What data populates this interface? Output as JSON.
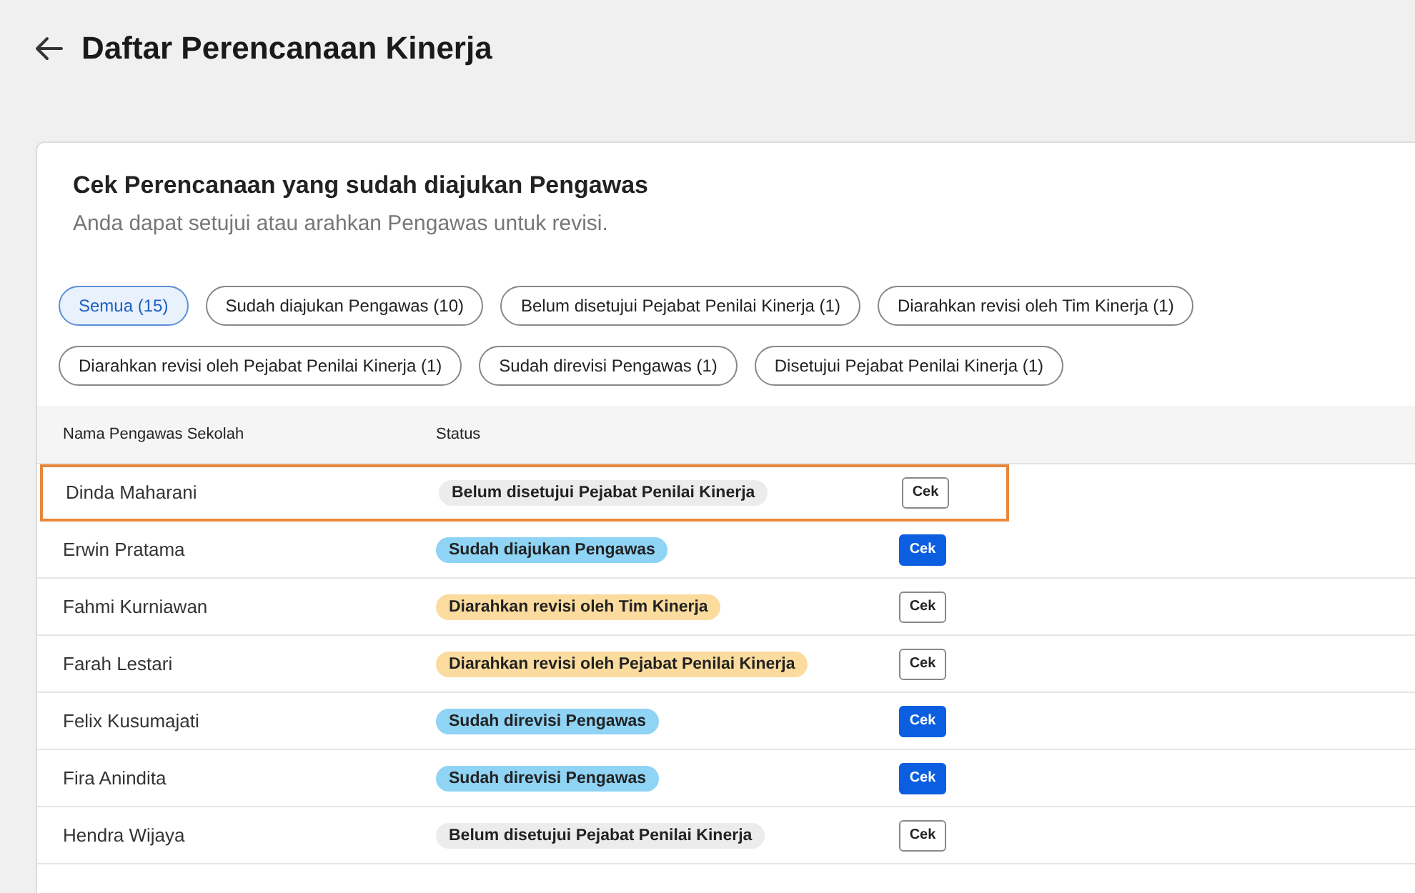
{
  "page": {
    "title": "Daftar Perencanaan Kinerja"
  },
  "card": {
    "title": "Cek Perencanaan yang sudah diajukan Pengawas",
    "subtitle": "Anda dapat setujui atau arahkan Pengawas untuk revisi."
  },
  "filters": [
    {
      "label": "Semua (15)",
      "selected": true
    },
    {
      "label": "Sudah diajukan Pengawas (10)",
      "selected": false
    },
    {
      "label": "Belum disetujui Pejabat Penilai Kinerja (1)",
      "selected": false
    },
    {
      "label": "Diarahkan revisi oleh Tim Kinerja (1)",
      "selected": false
    },
    {
      "label": "Diarahkan revisi oleh Pejabat Penilai Kinerja (1)",
      "selected": false
    },
    {
      "label": "Sudah direvisi Pengawas (1)",
      "selected": false
    },
    {
      "label": "Disetujui Pejabat Penilai Kinerja (1)",
      "selected": false
    }
  ],
  "table": {
    "columns": [
      "Nama Pengawas Sekolah",
      "Status"
    ],
    "rows": [
      {
        "name": "Dinda Maharani",
        "status": "Belum disetujui Pejabat Penilai Kinerja",
        "color": "#ececec",
        "action": "Cek",
        "primary": false,
        "highlighted": true
      },
      {
        "name": "Erwin Pratama",
        "status": "Sudah diajukan Pengawas",
        "color": "#8fd3f5",
        "action": "Cek",
        "primary": true,
        "highlighted": false
      },
      {
        "name": "Fahmi Kurniawan",
        "status": "Diarahkan revisi oleh Tim Kinerja",
        "color": "#fbdc9e",
        "action": "Cek",
        "primary": false,
        "highlighted": false
      },
      {
        "name": "Farah Lestari",
        "status": "Diarahkan revisi oleh Pejabat Penilai Kinerja",
        "color": "#fbdc9e",
        "action": "Cek",
        "primary": false,
        "highlighted": false
      },
      {
        "name": "Felix Kusumajati",
        "status": "Sudah direvisi Pengawas",
        "color": "#8fd3f5",
        "action": "Cek",
        "primary": true,
        "highlighted": false
      },
      {
        "name": "Fira Anindita",
        "status": "Sudah direvisi Pengawas",
        "color": "#8fd3f5",
        "action": "Cek",
        "primary": true,
        "highlighted": false
      },
      {
        "name": "Hendra Wijaya",
        "status": "Belum disetujui Pejabat Penilai Kinerja",
        "color": "#ececec",
        "action": "Cek",
        "primary": false,
        "highlighted": false
      }
    ]
  }
}
